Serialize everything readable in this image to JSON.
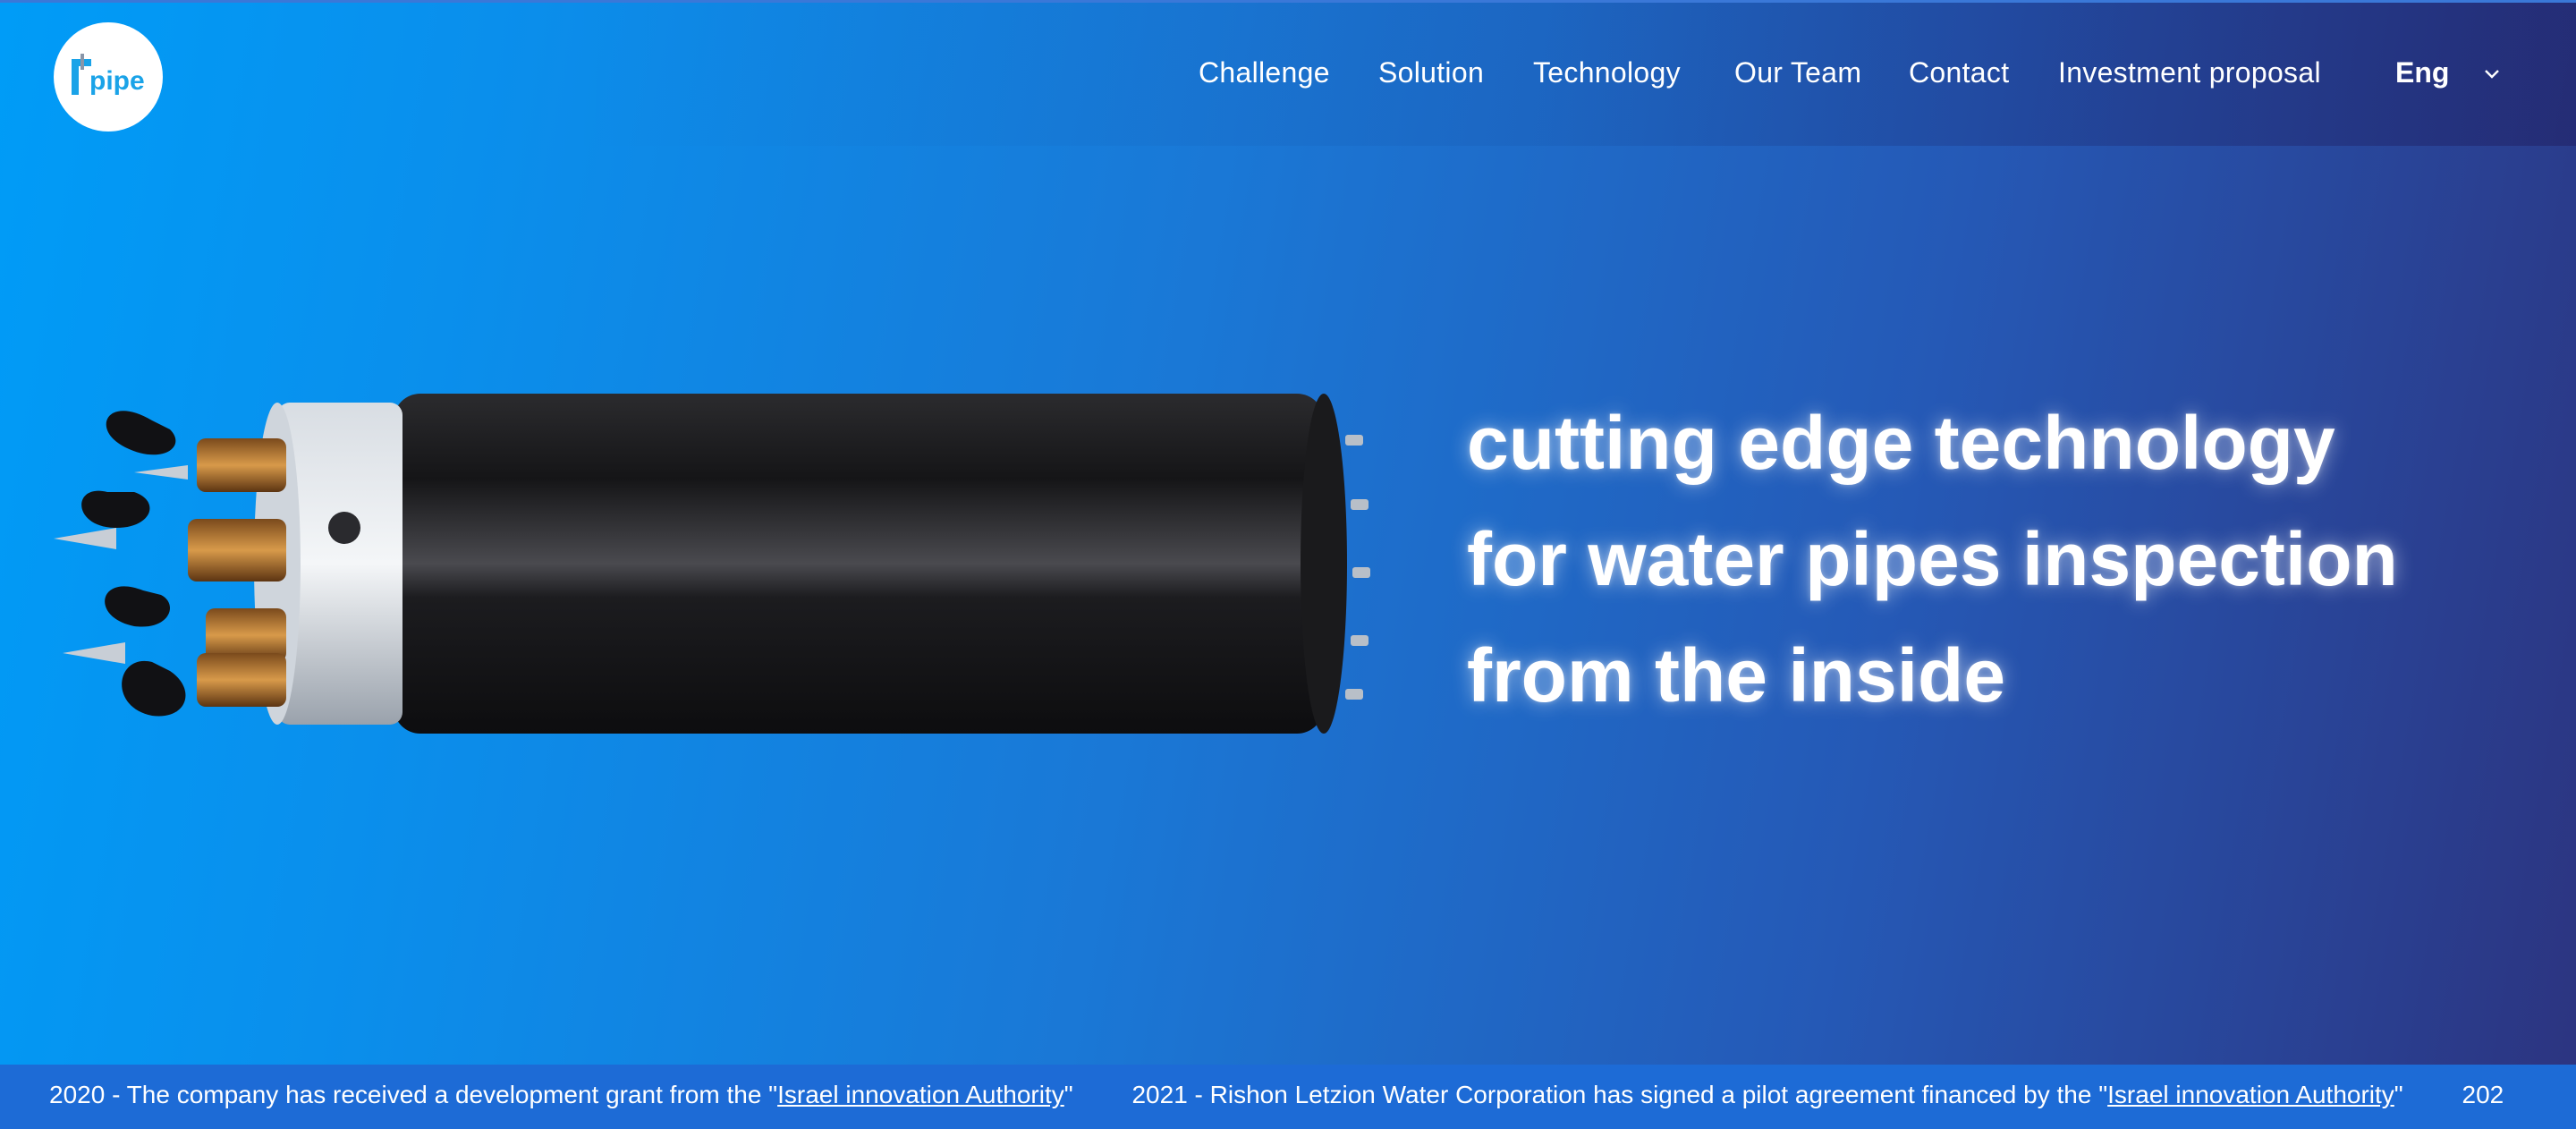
{
  "logo": {
    "text": "rpipe",
    "icon": "rpipe-logo"
  },
  "nav": {
    "items": [
      {
        "label": "Challenge"
      },
      {
        "label": "Solution"
      },
      {
        "label": "Technology"
      },
      {
        "label": "Our Team"
      },
      {
        "label": "Contact"
      },
      {
        "label": "Investment proposal"
      }
    ],
    "language": {
      "label": "Eng",
      "icon": "chevron-down-icon"
    }
  },
  "hero": {
    "line1": "cutting edge technology",
    "line2": "for water pipes inspection",
    "line3": "from the inside",
    "image": "pipe-inspection-robot"
  },
  "ticker": {
    "items": [
      {
        "text": "2020 - The company has received a development grant from the \"",
        "link": "Israel innovation Authority",
        "suffix": "\""
      },
      {
        "text": "2021 - Rishon Letzion Water Corporation has signed a pilot agreement financed by the \"",
        "link": "Israel innovation Authority",
        "suffix": "\""
      },
      {
        "text": "202"
      }
    ]
  },
  "colors": {
    "gradient_start": "#009cf7",
    "gradient_end": "#2c3480",
    "ticker_bg": "#1d6bd6",
    "logo_accent": "#1aa3e8"
  }
}
